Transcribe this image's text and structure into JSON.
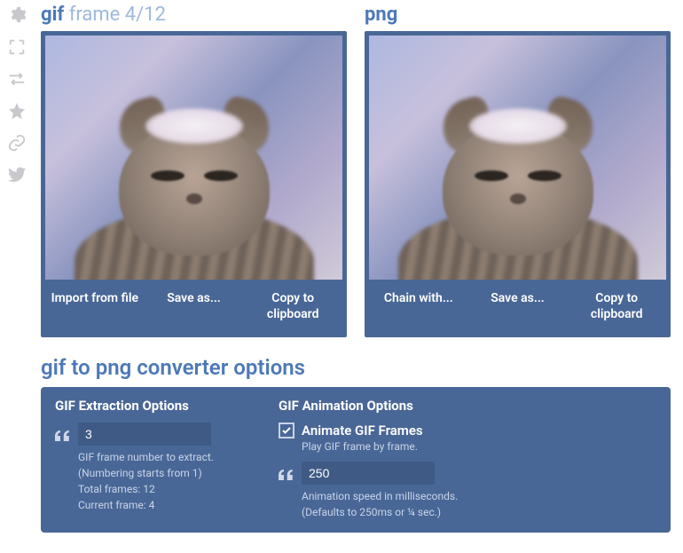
{
  "sidebar": {
    "icons": [
      "gear",
      "fullscreen",
      "swap",
      "star",
      "link",
      "twitter"
    ]
  },
  "left": {
    "title_bold": "gif",
    "title_light": "frame 4/12",
    "buttons": {
      "import": "Import from file",
      "save": "Save as...",
      "copy": "Copy to clipboard"
    }
  },
  "right": {
    "title_bold": "png",
    "buttons": {
      "chain": "Chain with...",
      "save": "Save as...",
      "copy": "Copy to clipboard"
    }
  },
  "options": {
    "title": "gif to png converter options",
    "extract": {
      "heading": "GIF Extraction Options",
      "frame_value": "3",
      "hint1": "GIF frame number to extract.",
      "hint2": "(Numbering starts from 1)",
      "hint3": "Total frames: 12",
      "hint4": "Current frame: 4"
    },
    "anim": {
      "heading": "GIF Animation Options",
      "checkbox_label": "Animate GIF Frames",
      "checkbox_hint": "Play GIF frame by frame.",
      "speed_value": "250",
      "speed_hint1": "Animation speed in milliseconds.",
      "speed_hint2": "(Defaults to 250ms or ¼ sec.)"
    }
  }
}
